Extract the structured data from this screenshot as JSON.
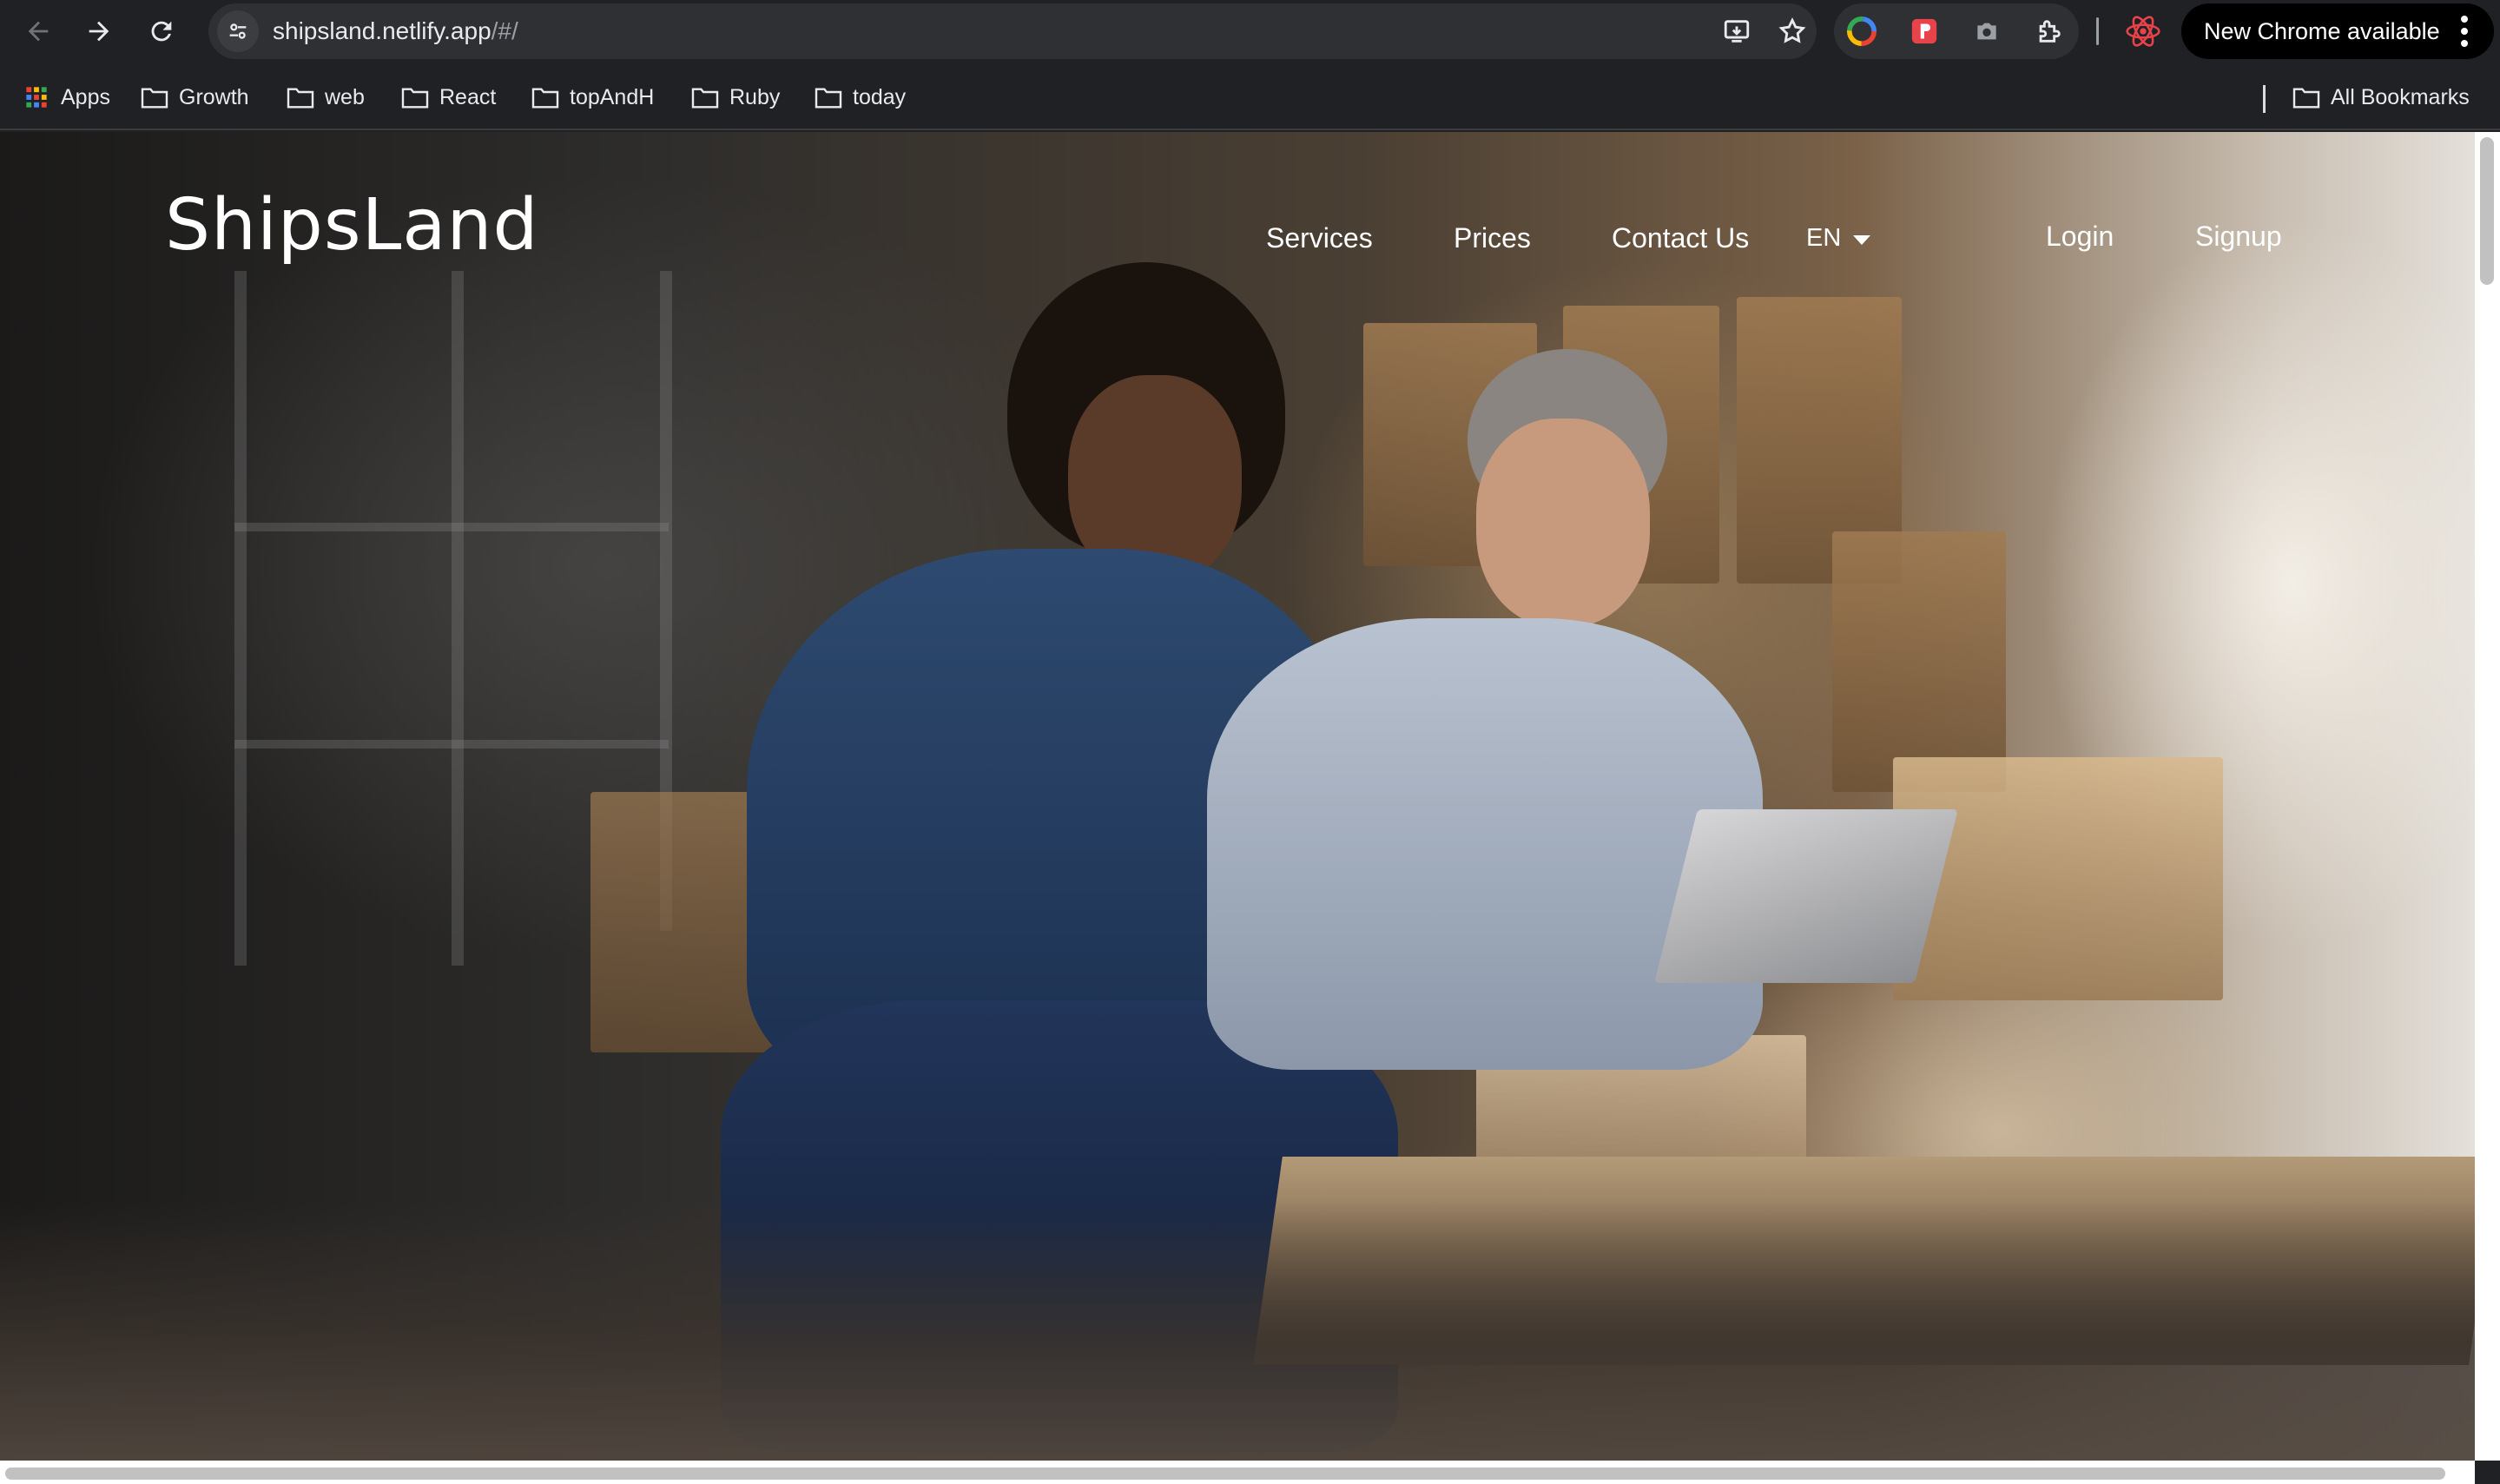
{
  "browser": {
    "url_host": "shipsland.netlify.app",
    "url_path": "/#/",
    "update_label": "New Chrome available",
    "icons": [
      "back-arrow-icon",
      "forward-arrow-icon",
      "reload-icon",
      "site-settings-icon",
      "install-app-icon",
      "bookmark-star-icon",
      "color-picker-extension-icon",
      "red-extension-icon",
      "camera-extension-icon",
      "extensions-puzzle-icon",
      "react-devtools-icon",
      "more-menu-icon"
    ]
  },
  "bookmarks": {
    "items": [
      {
        "label": "Apps",
        "icon": "apps-grid-icon"
      },
      {
        "label": "Growth",
        "icon": "folder-icon"
      },
      {
        "label": "web",
        "icon": "folder-icon"
      },
      {
        "label": "React",
        "icon": "folder-icon"
      },
      {
        "label": "topAndH",
        "icon": "folder-icon"
      },
      {
        "label": "Ruby",
        "icon": "folder-icon"
      },
      {
        "label": "today",
        "icon": "folder-icon"
      }
    ],
    "all_bookmarks": "All Bookmarks"
  },
  "site": {
    "logo": "ShipsLand",
    "nav": [
      "Services",
      "Prices",
      "Contact Us"
    ],
    "language": "EN",
    "login": "Login",
    "signup": "Signup"
  },
  "colors": {
    "chrome_bg": "#202124",
    "omnibox_bg": "#2f3033",
    "text_light": "#e8eaed",
    "site_text": "#ffffff"
  }
}
